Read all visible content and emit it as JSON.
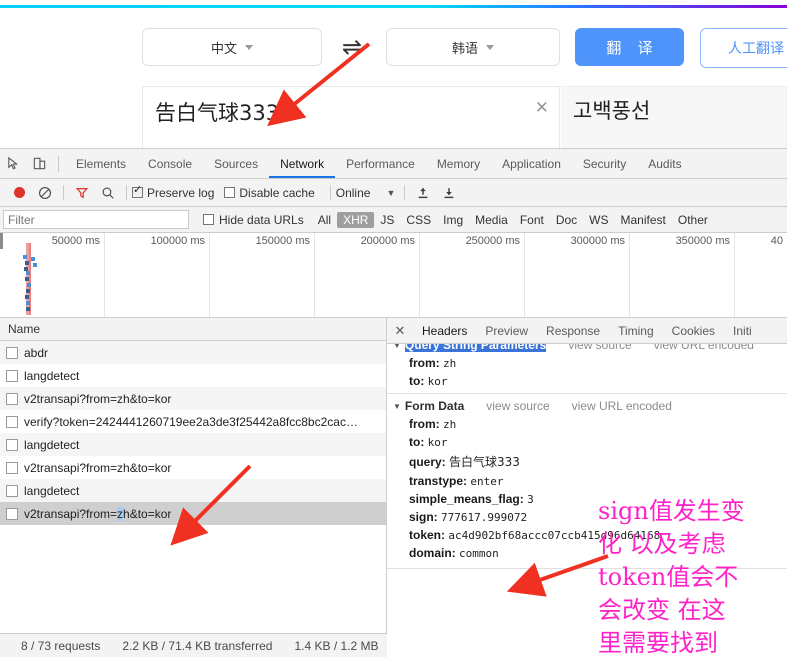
{
  "translate_page": {
    "lang_from": "中文",
    "lang_to": "韩语",
    "swap_icon": "⇌",
    "translate_button": "翻 译",
    "human_translate_button": "人工翻译",
    "source_text": "告白气球333",
    "clear_icon": "✕",
    "result_text": "고백풍선"
  },
  "devtools": {
    "inspect_icon": "inspect-element-icon",
    "device_icon": "device-toolbar-icon",
    "panels": [
      {
        "label": "Elements",
        "active": false
      },
      {
        "label": "Console",
        "active": false
      },
      {
        "label": "Sources",
        "active": false
      },
      {
        "label": "Network",
        "active": true
      },
      {
        "label": "Performance",
        "active": false
      },
      {
        "label": "Memory",
        "active": false
      },
      {
        "label": "Application",
        "active": false
      },
      {
        "label": "Security",
        "active": false
      },
      {
        "label": "Audits",
        "active": false
      }
    ],
    "toolbar": {
      "record_tooltip": "record-button",
      "clear_tooltip": "clear-button",
      "filter_tooltip": "filter-button",
      "search_tooltip": "search-button",
      "preserve_log_label": "Preserve log",
      "preserve_log_checked": true,
      "disable_cache_label": "Disable cache",
      "disable_cache_checked": false,
      "throttling_value": "Online",
      "throttling_caret": "▼",
      "import_tooltip": "import-har",
      "export_tooltip": "export-har"
    },
    "filterbar": {
      "filter_placeholder": "Filter",
      "filter_value": "",
      "hide_data_urls_label": "Hide data URLs",
      "hide_data_urls_checked": false,
      "types": [
        {
          "label": "All",
          "selected": false
        },
        {
          "label": "XHR",
          "selected": true
        },
        {
          "label": "JS",
          "selected": false
        },
        {
          "label": "CSS",
          "selected": false
        },
        {
          "label": "Img",
          "selected": false
        },
        {
          "label": "Media",
          "selected": false
        },
        {
          "label": "Font",
          "selected": false
        },
        {
          "label": "Doc",
          "selected": false
        },
        {
          "label": "WS",
          "selected": false
        },
        {
          "label": "Manifest",
          "selected": false
        },
        {
          "label": "Other",
          "selected": false
        }
      ]
    },
    "overview": {
      "ticks": [
        "50000 ms",
        "100000 ms",
        "150000 ms",
        "200000 ms",
        "250000 ms",
        "300000 ms",
        "350000 ms",
        "40"
      ]
    },
    "request_list": {
      "column_header": "Name",
      "rows": [
        {
          "name": "abdr",
          "selected": false
        },
        {
          "name": "langdetect",
          "selected": false
        },
        {
          "name": "v2transapi?from=zh&to=kor",
          "selected": false
        },
        {
          "name": "verify?token=2424441260719ee2a3de3f25442a8fcc8bc2cac…",
          "selected": false
        },
        {
          "name": "langdetect",
          "selected": false
        },
        {
          "name": "v2transapi?from=zh&to=kor",
          "selected": false
        },
        {
          "name": "langdetect",
          "selected": false
        },
        {
          "name": "v2transapi?from=zh&to=kor",
          "selected": true
        }
      ]
    },
    "details": {
      "close_icon": "✕",
      "tabs": [
        {
          "label": "Headers",
          "active": true
        },
        {
          "label": "Preview",
          "active": false
        },
        {
          "label": "Response",
          "active": false
        },
        {
          "label": "Timing",
          "active": false
        },
        {
          "label": "Cookies",
          "active": false
        },
        {
          "label": "Initi",
          "active": false
        }
      ],
      "query_section": {
        "title": "Query String Parameters",
        "view_source": "view source",
        "view_url_encoded": "view URL encoded",
        "params": [
          {
            "key": "from:",
            "value": "zh"
          },
          {
            "key": "to:",
            "value": "kor"
          }
        ]
      },
      "form_section": {
        "title": "Form Data",
        "view_source": "view source",
        "view_url_encoded": "view URL encoded",
        "params": [
          {
            "key": "from:",
            "value": "zh"
          },
          {
            "key": "to:",
            "value": "kor"
          },
          {
            "key": "query:",
            "value": "告白气球333"
          },
          {
            "key": "transtype:",
            "value": "enter"
          },
          {
            "key": "simple_means_flag:",
            "value": "3"
          },
          {
            "key": "sign:",
            "value": "777617.999072"
          },
          {
            "key": "token:",
            "value": "ac4d902bf68accc07ccb415d96d64168"
          },
          {
            "key": "domain:",
            "value": "common"
          }
        ]
      }
    },
    "statusbar": {
      "requests": "8 / 73 requests",
      "transferred": "2.2 KB / 71.4 KB transferred",
      "resources": "1.4 KB / 1.2 MB"
    }
  },
  "annotations": {
    "pink_note_lines": [
      "sign值发生变",
      "化 以及考虑",
      "token值会不",
      "会改变 在这",
      "里需要找到"
    ],
    "arrow_color": "#f03020",
    "note_color": "#ff22c8"
  }
}
